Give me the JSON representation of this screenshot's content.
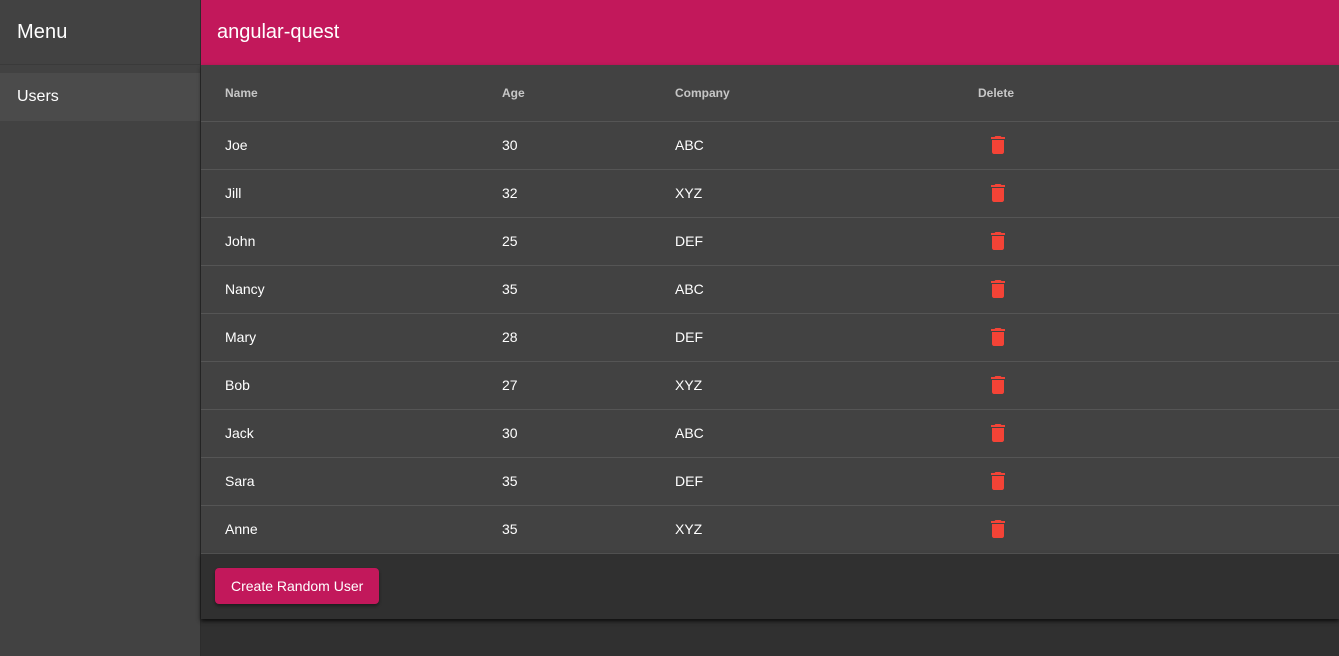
{
  "sidebar": {
    "title": "Menu",
    "items": [
      {
        "label": "Users"
      }
    ]
  },
  "toolbar": {
    "title": "angular-quest"
  },
  "table": {
    "columns": [
      "Name",
      "Age",
      "Company",
      "Delete"
    ],
    "rows": [
      {
        "name": "Joe",
        "age": "30",
        "company": "ABC"
      },
      {
        "name": "Jill",
        "age": "32",
        "company": "XYZ"
      },
      {
        "name": "John",
        "age": "25",
        "company": "DEF"
      },
      {
        "name": "Nancy",
        "age": "35",
        "company": "ABC"
      },
      {
        "name": "Mary",
        "age": "28",
        "company": "DEF"
      },
      {
        "name": "Bob",
        "age": "27",
        "company": "XYZ"
      },
      {
        "name": "Jack",
        "age": "30",
        "company": "ABC"
      },
      {
        "name": "Sara",
        "age": "35",
        "company": "DEF"
      },
      {
        "name": "Anne",
        "age": "35",
        "company": "XYZ"
      }
    ],
    "delete_icon": "trash-icon"
  },
  "footer": {
    "create_label": "Create Random User"
  },
  "colors": {
    "accent": "#c2185b",
    "delete": "#f44336",
    "sidebar_bg": "#424242",
    "background": "#303030"
  }
}
